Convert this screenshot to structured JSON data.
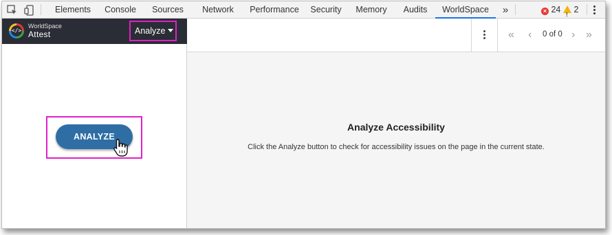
{
  "devtools": {
    "tabs": [
      {
        "label": "Elements"
      },
      {
        "label": "Console"
      },
      {
        "label": "Sources"
      },
      {
        "label": "Network"
      },
      {
        "label": "Performance"
      },
      {
        "label": "Security"
      },
      {
        "label": "Memory"
      },
      {
        "label": "Audits"
      },
      {
        "label": "WorldSpace"
      }
    ],
    "active_tab": "WorldSpace",
    "more_tabs": "»",
    "error_count": "24",
    "warning_count": "2"
  },
  "brand": {
    "line1": "WorldSpace",
    "line2": "Attest"
  },
  "menu": {
    "analyze_label": "Analyze"
  },
  "left": {
    "analyze_button_label": "ANALYZE"
  },
  "pager": {
    "text": "0 of 0"
  },
  "main": {
    "title": "Analyze Accessibility",
    "description": "Click the Analyze button to check for accessibility issues on the page in the current state."
  },
  "colors": {
    "brand_bar": "#2a2d35",
    "button": "#2f6ea5",
    "highlight": "#e020c8",
    "active_tab_underline": "#1a73e8"
  }
}
